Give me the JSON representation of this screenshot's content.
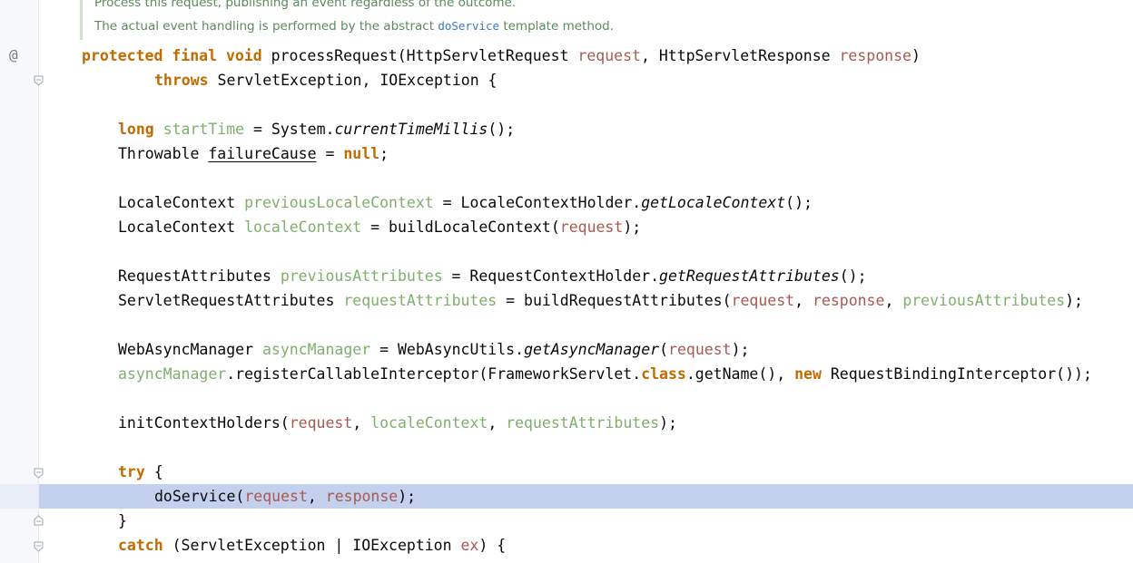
{
  "doc": {
    "line1": "Process this request, publishing an event regardless of the outcome.",
    "line2_prefix": "The actual event handling is performed by the abstract ",
    "line2_code": "doService",
    "line2_suffix": " template method."
  },
  "gutter": {
    "annotation_symbol": "@"
  },
  "code": {
    "l1": {
      "protected": "protected",
      "final": "final",
      "void": "void",
      "method": "processRequest(HttpServletRequest ",
      "p1": "request",
      "mid": ", HttpServletResponse ",
      "p2": "response",
      "close": ")"
    },
    "l2": {
      "throws": "throws",
      "rest": " ServletException, IOException {"
    },
    "l3": {
      "long": "long",
      "var": "startTime",
      "mid": " = System.",
      "call": "currentTimeMillis",
      "end": "();"
    },
    "l4": {
      "type": "Throwable ",
      "var": "failureCause",
      "mid": " = ",
      "null": "null",
      "end": ";"
    },
    "l5": {
      "type": "LocaleContext ",
      "var": "previousLocaleContext",
      "mid": " = LocaleContextHolder.",
      "call": "getLocaleContext",
      "end": "();"
    },
    "l6": {
      "type": "LocaleContext ",
      "var": "localeContext",
      "mid": " = buildLocaleContext(",
      "p": "request",
      "end": ");"
    },
    "l7": {
      "type": "RequestAttributes ",
      "var": "previousAttributes",
      "mid": " = RequestContextHolder.",
      "call": "getRequestAttributes",
      "end": "();"
    },
    "l8": {
      "type": "ServletRequestAttributes ",
      "var": "requestAttributes",
      "mid": " = buildRequestAttributes(",
      "p1": "request",
      "c1": ", ",
      "p2": "response",
      "c2": ", ",
      "v": "previousAttributes",
      "end": ");"
    },
    "l9": {
      "type": "WebAsyncManager ",
      "var": "asyncManager",
      "mid": " = WebAsyncUtils.",
      "call": "getAsyncManager",
      "open": "(",
      "p": "request",
      "end": ");"
    },
    "l10": {
      "var": "asyncManager",
      "mid": ".registerCallableInterceptor(FrameworkServlet.",
      "class": "class",
      "mid2": ".getName(), ",
      "new": "new",
      "end": " RequestBindingInterceptor());"
    },
    "l11": {
      "call": "initContextHolders(",
      "p": "request",
      "c1": ", ",
      "v1": "localeContext",
      "c2": ", ",
      "v2": "requestAttributes",
      "end": ");"
    },
    "l12": {
      "try": "try",
      "end": " {"
    },
    "l13": {
      "call": "doService(",
      "p1": "request",
      "c": ", ",
      "p2": "response",
      "end": ");"
    },
    "l14": {
      "brace": "}"
    },
    "l15": {
      "catch": "catch",
      "mid": " (ServletException | IOException ",
      "p": "ex",
      "end": ") {"
    }
  }
}
